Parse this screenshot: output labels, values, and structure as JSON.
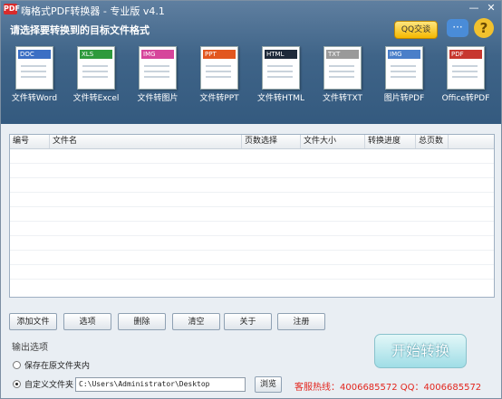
{
  "window": {
    "title": "嗨格式PDF转换器 - 专业版 v4.1",
    "min_glyph": "—",
    "close_glyph": "✕"
  },
  "header": {
    "subtitle": "请选择要转换到的目标文件格式",
    "qq_button": "QQ交谈",
    "chat_icon_glyph": "···",
    "help_icon_glyph": "?",
    "app_logo_text": "PDF"
  },
  "tiles": [
    {
      "badge": "DOC",
      "label": "文件转Word",
      "color": "#3b6fc4"
    },
    {
      "badge": "XLS",
      "label": "文件转Excel",
      "color": "#2e9a3d"
    },
    {
      "badge": "IMG",
      "label": "文件转图片",
      "color": "#d6459b"
    },
    {
      "badge": "PPT",
      "label": "文件转PPT",
      "color": "#e2571f"
    },
    {
      "badge": "HTML",
      "label": "文件转HTML",
      "color": "#1e2a3a"
    },
    {
      "badge": "TXT",
      "label": "文件转TXT",
      "color": "#9a9a9a"
    },
    {
      "badge": "IMG",
      "label": "图片转PDF",
      "color": "#4a7fc9"
    },
    {
      "badge": "PDF",
      "label": "Office转PDF",
      "color": "#c7372f"
    }
  ],
  "table": {
    "columns": [
      "编号",
      "文件名",
      "页数选择",
      "文件大小",
      "转换进度",
      "总页数"
    ],
    "rows": []
  },
  "buttons": {
    "add": "添加文件",
    "options": "选项",
    "delete": "删除",
    "clear": "清空",
    "about": "关于",
    "register": "注册"
  },
  "output": {
    "title": "输出选项",
    "option_original": "保存在原文件夹内",
    "option_custom": "自定义文件夹",
    "selected": "custom",
    "path": "C:\\Users\\Administrator\\Desktop",
    "browse": "浏览"
  },
  "start_button": "开始转换",
  "contact": "客服热线：4006685572 QQ：4006685572"
}
